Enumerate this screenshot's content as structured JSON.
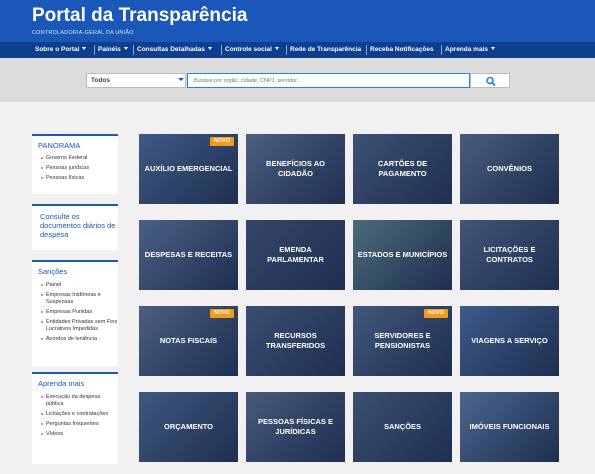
{
  "header": {
    "title": "Portal da Transparência",
    "subtitle": "CONTROLADORIA-GERAL DA UNIÃO"
  },
  "nav": {
    "items": [
      {
        "label": "Sobre o Portal",
        "dropdown": true
      },
      {
        "label": "Painéis",
        "dropdown": true
      },
      {
        "label": "Consultas Detalhadas",
        "dropdown": true
      },
      {
        "label": "Controle social",
        "dropdown": true
      },
      {
        "label": "Rede de Transparência",
        "dropdown": false
      },
      {
        "label": "Receba Notificações",
        "dropdown": false
      },
      {
        "label": "Aprenda mais",
        "dropdown": true
      }
    ]
  },
  "search": {
    "select_value": "Todos",
    "placeholder": "Busque por orgão, cidade, CNPJ, servidor...",
    "button_icon": "search-icon"
  },
  "sidebar": {
    "panorama": {
      "title": "PANORAMA",
      "links": [
        "Governo Federal",
        "Pessoas jurídicas",
        "Pessoas físicas"
      ]
    },
    "consulte": {
      "title": "Consulte os documentos diários de despesa"
    },
    "sancoes": {
      "title": "Sanções",
      "links": [
        "Painel",
        "Empresas Inidôneas e Suspensas",
        "Empresas Punidas",
        "Entidades Privadas sem Fins Lucrativos Impedidas",
        "Acordos de leniência"
      ]
    },
    "aprenda": {
      "title": "Aprenda mais",
      "links": [
        "Execução da despesa pública",
        "Licitações e contratações",
        "Perguntas frequentes",
        "Vídeos"
      ]
    }
  },
  "tiles": [
    {
      "label": "AUXÍLIO EMERGENCIAL",
      "badge": "NOVO",
      "color": "#3e5a86"
    },
    {
      "label": "BENEFÍCIOS AO CIDADÃO",
      "badge": "",
      "color": "#4a5f82"
    },
    {
      "label": "CARTÕES DE PAGAMENTO",
      "badge": "",
      "color": "#3d5176"
    },
    {
      "label": "CONVÊNIOS",
      "badge": "",
      "color": "#475c7e"
    },
    {
      "label": "DESPESAS E RECEITAS",
      "badge": "",
      "color": "#4b6087"
    },
    {
      "label": "EMENDA PARLAMENTAR",
      "badge": "",
      "color": "#34466a"
    },
    {
      "label": "ESTADOS E MUNICÍPIOS",
      "badge": "",
      "color": "#4c6a7a"
    },
    {
      "label": "LICITAÇÕES E CONTRATOS",
      "badge": "",
      "color": "#40557a"
    },
    {
      "label": "NOTAS FISCAIS",
      "badge": "NOVO",
      "color": "#4a5f84"
    },
    {
      "label": "RECURSOS TRANSFERIDOS",
      "badge": "",
      "color": "#3a4e74"
    },
    {
      "label": "SERVIDORES E PENSIONISTAS",
      "badge": "NOVO",
      "color": "#42577c"
    },
    {
      "label": "VIAGENS A SERVIÇO",
      "badge": "",
      "color": "#3c5a8c"
    },
    {
      "label": "ORÇAMENTO",
      "badge": "",
      "color": "#3f5880"
    },
    {
      "label": "PESSOAS FÍSICAS E JURÍDICAS",
      "badge": "",
      "color": "#475a7c"
    },
    {
      "label": "SANÇÕES",
      "badge": "",
      "color": "#3b4f72"
    },
    {
      "label": "IMÓVEIS FUNCIONAIS",
      "badge": "",
      "color": "#4a6690"
    }
  ]
}
